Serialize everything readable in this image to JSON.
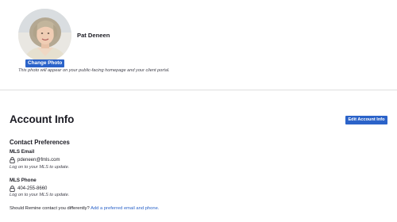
{
  "profile": {
    "name": "Pat Deneen",
    "change_photo_label": "Change Photo",
    "photo_note": "This photo will appear on your public-facing homepage and your client portal."
  },
  "account": {
    "title": "Account Info",
    "edit_button_label": "Edit Account Info"
  },
  "contact_preferences": {
    "heading": "Contact Preferences",
    "fields": [
      {
        "label": "MLS Email",
        "icon": "lock-icon",
        "value": "pdeneen@fmls.com",
        "hint": "Log on to your MLS to update."
      },
      {
        "label": "MLS Phone",
        "icon": "lock-icon",
        "value": "404-255-8660",
        "hint": "Log on to your MLS to update."
      }
    ],
    "footer_prefix": "Should Remine contact you differently?",
    "footer_link": "Add a preferred email and phone."
  },
  "colors": {
    "accent": "#2b63c9",
    "text": "#1c1c24",
    "muted": "#45454f",
    "divider": "#dedede"
  }
}
